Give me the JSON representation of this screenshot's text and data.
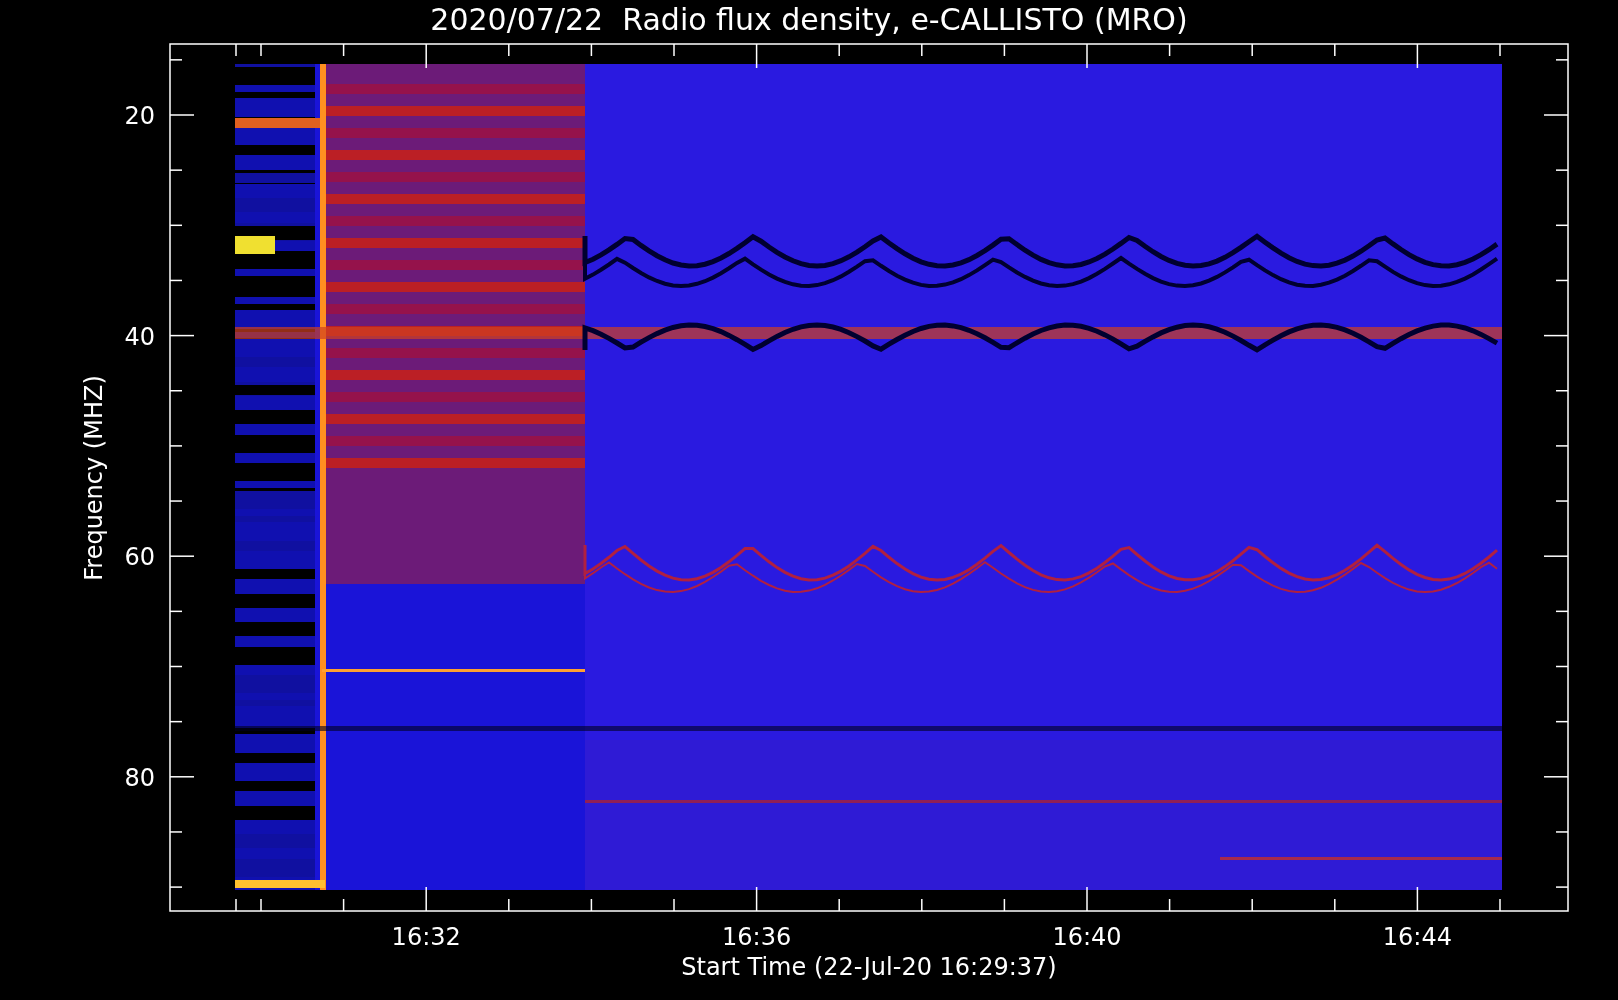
{
  "title": "2020/07/22  Radio flux density, e-CALLISTO (MRO)",
  "y_axis": {
    "label": "Frequency (MHZ)",
    "ticks": [
      "20",
      "40",
      "60",
      "80"
    ]
  },
  "x_axis": {
    "label": "Start Time (22-Jul-20 16:29:37)",
    "ticks": [
      "16:32",
      "16:36",
      "16:40",
      "16:44"
    ]
  }
}
